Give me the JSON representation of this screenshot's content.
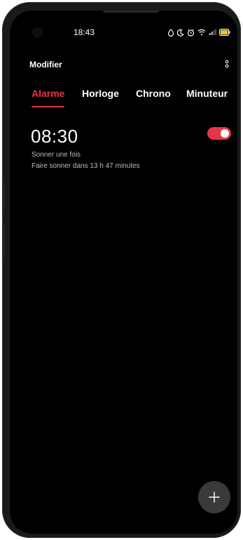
{
  "status_bar": {
    "time": "18:43",
    "icons": [
      "alarm-icon",
      "moon-icon",
      "clock-icon",
      "wifi-icon",
      "signal-icon",
      "battery-icon"
    ]
  },
  "header": {
    "title": "Modifier",
    "menu_icon": "more-vert-icon"
  },
  "tabs": [
    {
      "label": "Alarme",
      "active": true
    },
    {
      "label": "Horloge",
      "active": false
    },
    {
      "label": "Chrono",
      "active": false
    },
    {
      "label": "Minuteur",
      "active": false
    }
  ],
  "alarm": {
    "time": "08:30",
    "repeat": "Sonner une fois",
    "countdown": "Faire sonner dans 13 h 47 minutes",
    "enabled": true
  },
  "fab": {
    "icon": "plus-icon"
  },
  "colors": {
    "accent": "#e8344a",
    "background": "#000000",
    "battery": "#f5c518"
  }
}
